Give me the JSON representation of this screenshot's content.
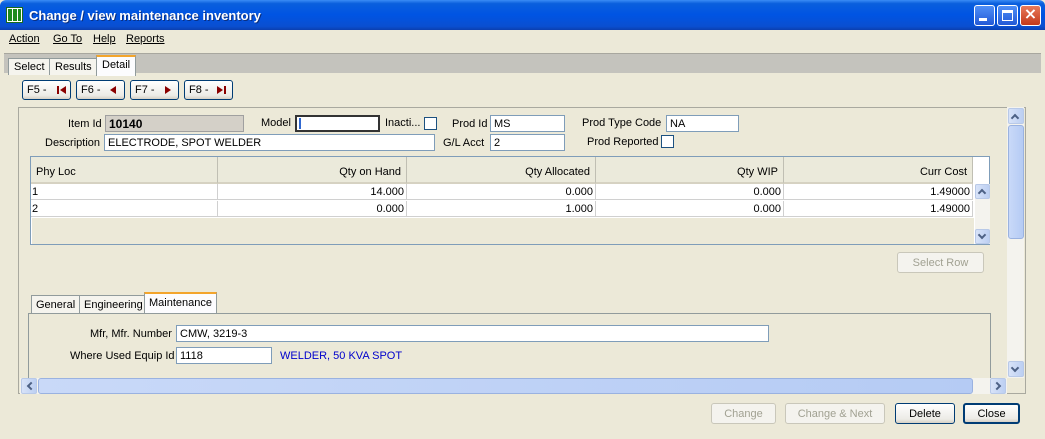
{
  "window": {
    "title": "Change / view maintenance inventory"
  },
  "menu": {
    "items": [
      "Action",
      "Go To",
      "Help",
      "Reports"
    ]
  },
  "tabs": [
    "Select",
    "Results",
    "Detail"
  ],
  "nav_buttons": [
    "F5 -",
    "F6 -",
    "F7 -",
    "F8 -"
  ],
  "form": {
    "item_id_label": "Item Id",
    "item_id": "10140",
    "model_label": "Model",
    "model": "",
    "inactive_label": "Inacti...",
    "prod_id_label": "Prod Id",
    "prod_id": "MS",
    "prod_type_code_label": "Prod Type Code",
    "prod_type_code": "NA",
    "description_label": "Description",
    "description": "ELECTRODE, SPOT WELDER",
    "gl_acct_label": "G/L Acct",
    "gl_acct": "2",
    "prod_reported_label": "Prod Reported"
  },
  "grid": {
    "columns": [
      "Phy Loc",
      "Qty on Hand",
      "Qty Allocated",
      "Qty WIP",
      "Curr Cost"
    ],
    "rows": [
      [
        "1",
        "14.000",
        "0.000",
        "0.000",
        "1.49000"
      ],
      [
        "2",
        "0.000",
        "1.000",
        "0.000",
        "1.49000"
      ]
    ]
  },
  "select_row_label": "Select Row",
  "subtabs": [
    "General",
    "Engineering",
    "Maintenance"
  ],
  "maintenance": {
    "mfr_label": "Mfr, Mfr. Number",
    "mfr_value": "CMW, 3219-3",
    "where_used_label": "Where Used Equip Id",
    "where_used_value": "1118",
    "equip_desc": "WELDER, 50 KVA SPOT"
  },
  "actions": {
    "change": "Change",
    "change_next": "Change & Next",
    "delete": "Delete",
    "close": "Close"
  },
  "colors": {
    "title_bar": "#0054e3",
    "link_text": "#0000cc",
    "nav_arrow": "#8b0000"
  }
}
